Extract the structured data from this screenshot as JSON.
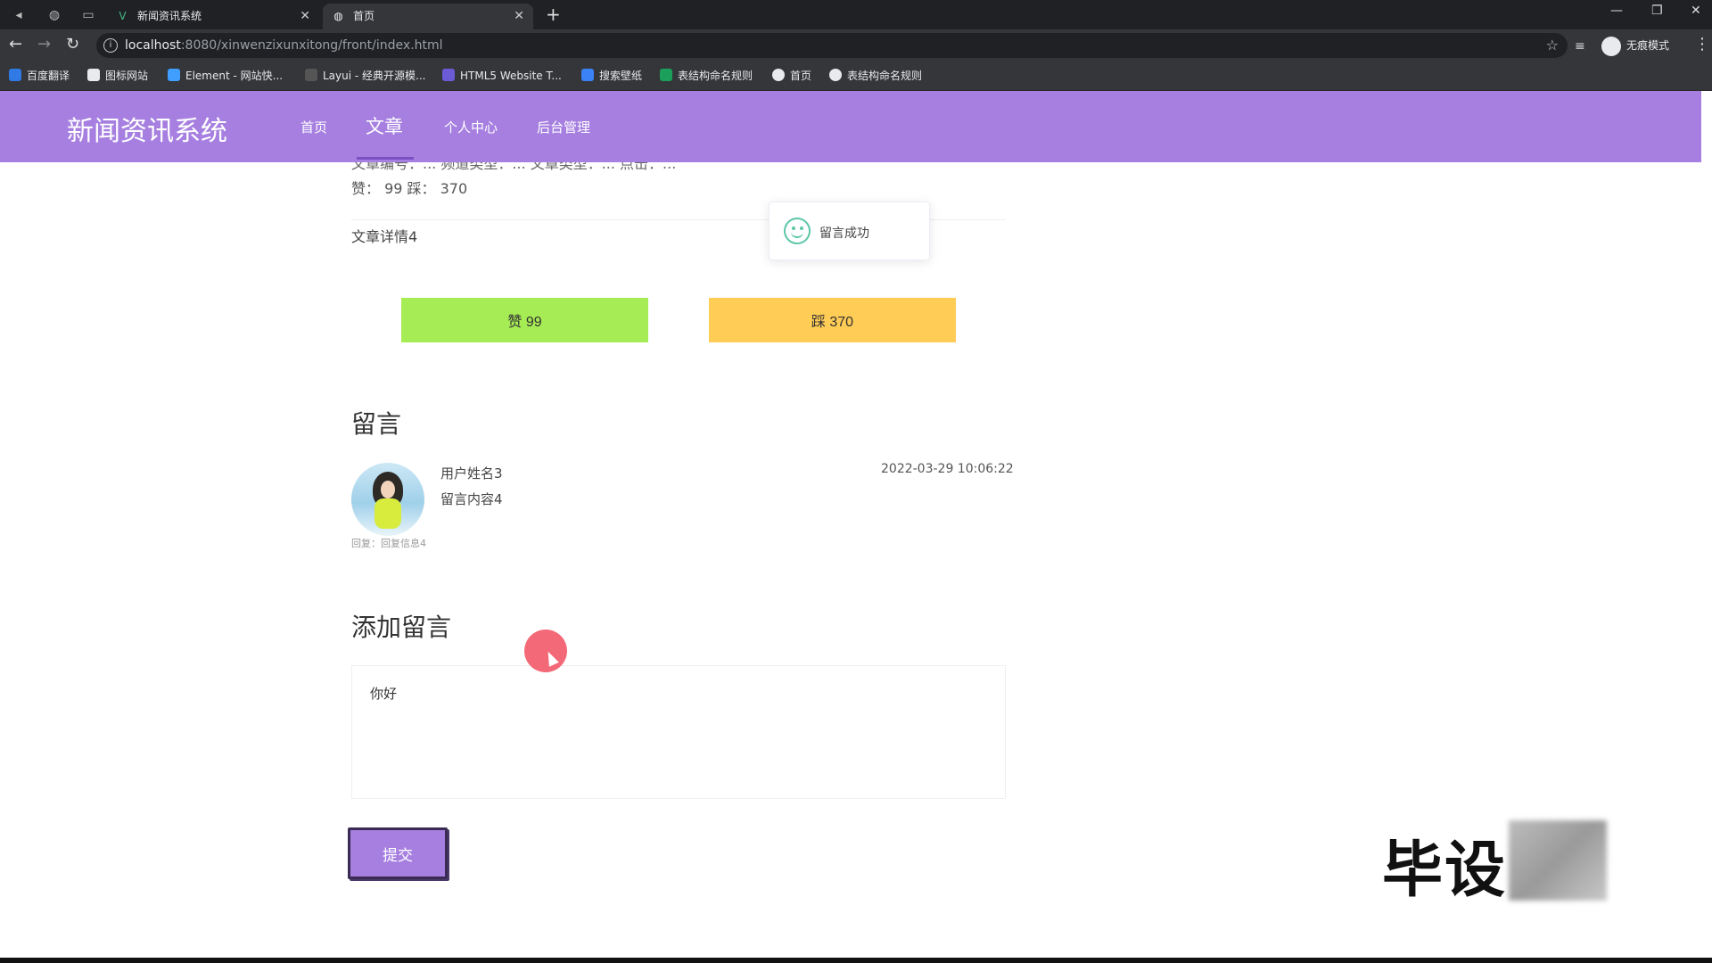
{
  "browser": {
    "tabs": [
      {
        "title": "新闻资讯系统",
        "favicon": "vue-logo-icon"
      },
      {
        "title": "首页",
        "favicon": "globe-icon"
      }
    ],
    "url_host": "localhost",
    "url_rest": ":8080/xinwenzixunxitong/front/index.html",
    "profile_label": "无痕模式",
    "bookmarks": [
      {
        "label": "百度翻译",
        "color": "#2f7ae5"
      },
      {
        "label": "图标网站",
        "color": "#e8eaed"
      },
      {
        "label": "Element - 网站快...",
        "color": "#409eff"
      },
      {
        "label": "Layui - 经典开源模...",
        "color": "#444"
      },
      {
        "label": "HTML5 Website T...",
        "color": "#6b5bd6"
      },
      {
        "label": "搜索壁纸",
        "color": "#3b82f6"
      },
      {
        "label": "表结构命名规则",
        "color": "#1aa05a"
      },
      {
        "label": "首页",
        "color": "#e8eaed"
      },
      {
        "label": "表结构命名规则",
        "color": "#e8eaed"
      }
    ]
  },
  "header": {
    "brand": "新闻资讯系统",
    "nav": [
      "首页",
      "文章",
      "个人中心",
      "后台管理"
    ],
    "active": "文章"
  },
  "article": {
    "meta_cut": "文章编号：... 频道类型：... 文章类型：... 点击：...",
    "votes_line": "赞：  99    踩：  370",
    "body": "文章详情4",
    "like_label": "赞    99",
    "dislike_label": "踩    370"
  },
  "toast": {
    "message": "留言成功"
  },
  "comments": {
    "title": "留言",
    "items": [
      {
        "name": "用户姓名3",
        "content": "留言内容4",
        "time": "2022-03-29 10:06:22",
        "reply": "回复：回复信息4"
      }
    ]
  },
  "add_comment": {
    "title": "添加留言",
    "value": "你好",
    "submit_label": "提交"
  },
  "watermark": "毕设"
}
